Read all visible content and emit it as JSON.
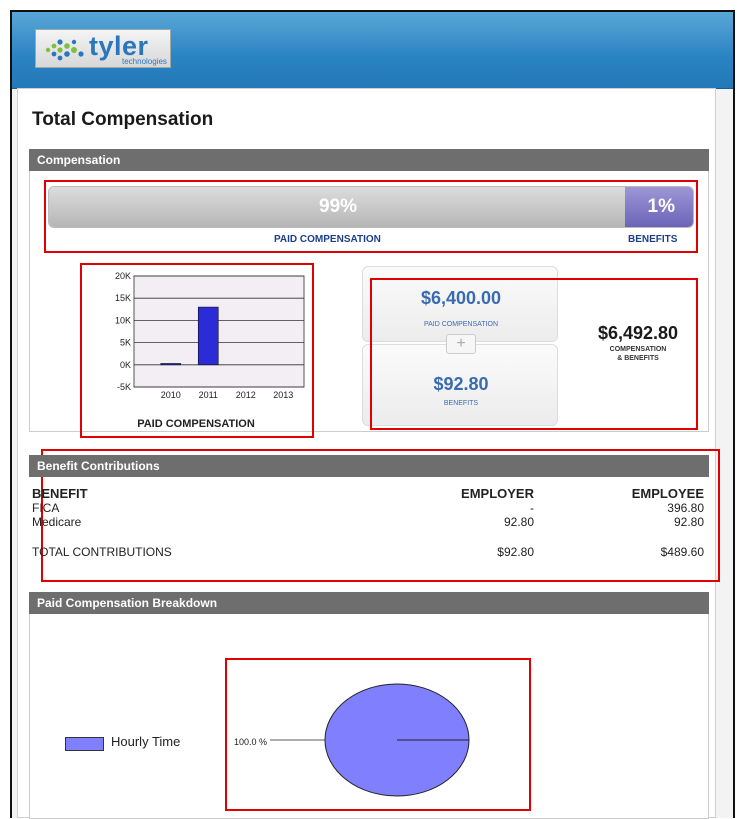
{
  "logo": {
    "name": "tyler",
    "sub": "technologies"
  },
  "page_title": "Total Compensation",
  "compensation": {
    "section_title": "Compensation",
    "paid_pct": "99%",
    "benefits_pct": "1%",
    "paid_label": "PAID COMPENSATION",
    "benefits_label": "BENEFITS",
    "paid_amount": "$6,400.00",
    "paid_amount_label": "PAID COMPENSATION",
    "benefits_amount": "$92.80",
    "benefits_amount_label": "BENEFITS",
    "total_amount": "$6,492.80",
    "total_label_1": "COMPENSATION",
    "total_label_2": "& BENEFITS",
    "plus_symbol": "+"
  },
  "chart_data": [
    {
      "type": "bar",
      "categories": [
        "2010",
        "2011",
        "2012",
        "2013"
      ],
      "values": [
        300,
        13000,
        0,
        0
      ],
      "title": "PAID COMPENSATION",
      "xlabel": "",
      "ylabel": "",
      "ylim": [
        -5000,
        20000
      ],
      "yticks": [
        "20K",
        "15K",
        "10K",
        "5K",
        "0K",
        "-5K"
      ],
      "ytick_values": [
        20000,
        15000,
        10000,
        5000,
        0,
        -5000
      ],
      "grid": true,
      "bar_color": "#2b2bd8"
    },
    {
      "type": "pie",
      "labels": [
        "Hourly Time"
      ],
      "values": [
        100
      ],
      "slice_label": "100.0 %",
      "color": "#8080ff",
      "legend": "left"
    }
  ],
  "benefits": {
    "section_title": "Benefit Contributions",
    "headers": [
      "BENEFIT",
      "EMPLOYER",
      "EMPLOYEE"
    ],
    "rows": [
      [
        "FICA",
        "-",
        "396.80"
      ],
      [
        "Medicare",
        "92.80",
        "92.80"
      ]
    ],
    "total": [
      "TOTAL CONTRIBUTIONS",
      "$92.80",
      "$489.60"
    ]
  },
  "breakdown": {
    "section_title": "Paid Compensation Breakdown"
  },
  "colors": {
    "header_blue": "#2a83c2",
    "section_gray": "#6e6e6e",
    "highlight_red": "#e00000",
    "benefits_purple": "#6b63b8",
    "amount_blue": "#3a6bb0"
  }
}
